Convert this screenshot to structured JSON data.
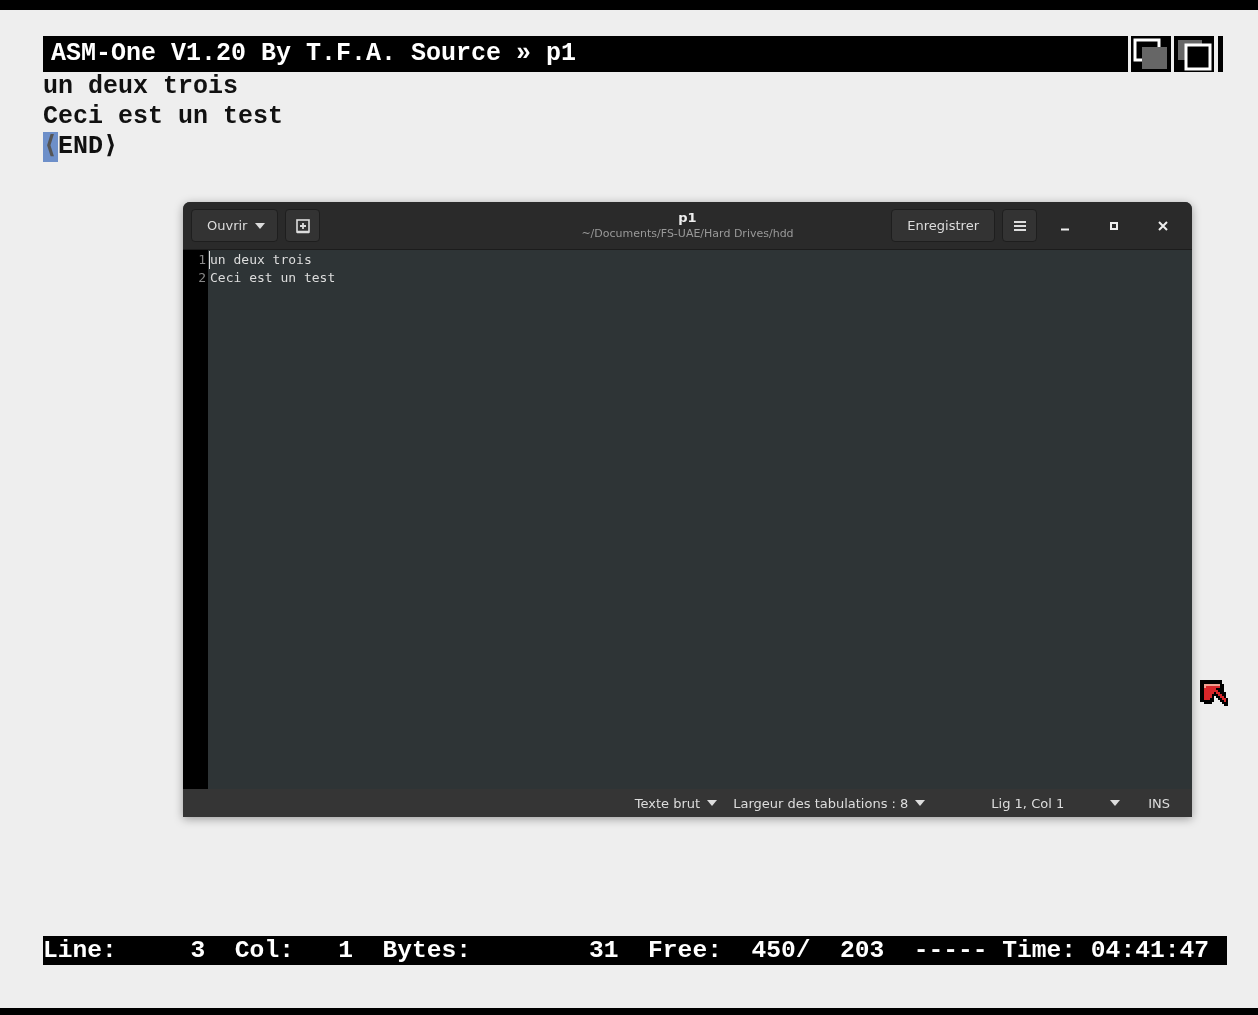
{
  "amiga": {
    "title": "ASM-One V1.20 By T.F.A. Source » p1",
    "lines": [
      "un deux trois",
      "Ceci est un test"
    ],
    "end_marker": {
      "cursor": "⟨",
      "text": "END⟩"
    },
    "status_line": "Line:     3  Col:   1  Bytes:        31  Free:  450/  203  ----- Time: 04:41:47"
  },
  "editor": {
    "open_button": "Ouvrir",
    "title": "p1",
    "subtitle": "~/Documents/FS-UAE/Hard Drives/hdd",
    "save_button": "Enregistrer",
    "lines": [
      {
        "number": "1",
        "text": "un deux trois"
      },
      {
        "number": "2",
        "text": "Ceci est un test"
      }
    ],
    "status_bar": {
      "language": "Texte brut",
      "tab_width": "Largeur des tabulations : 8",
      "position": "Lig 1, Col 1",
      "mode": "INS"
    }
  }
}
